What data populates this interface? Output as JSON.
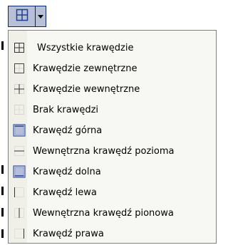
{
  "toolbar": {
    "button_icon": "all-borders-icon",
    "dropdown_icon": "dropdown-arrow-icon"
  },
  "menu": {
    "items": [
      {
        "label": "Wszystkie krawędzie",
        "icon": "all-borders-icon"
      },
      {
        "label": "Krawędzie zewnętrzne",
        "icon": "outside-borders-icon"
      },
      {
        "label": "Krawędzie wewnętrzne",
        "icon": "inside-borders-icon"
      },
      {
        "label": "Brak krawędzi",
        "icon": "no-border-icon"
      },
      {
        "label": "Krawędź górna",
        "icon": "top-border-icon"
      },
      {
        "label": "Wewnętrzna krawędź pozioma",
        "icon": "inside-horizontal-border-icon"
      },
      {
        "label": "Krawędź dolna",
        "icon": "bottom-border-icon"
      },
      {
        "label": "Krawędź lewa",
        "icon": "left-border-icon"
      },
      {
        "label": "Wewnętrzna krawędź pionowa",
        "icon": "inside-vertical-border-icon"
      },
      {
        "label": "Krawędź prawa",
        "icon": "right-border-icon"
      }
    ]
  },
  "colors": {
    "toolbar_selected": "#b7c0d6",
    "toolbar_border": "#0a246a",
    "menu_background": "#f7f7f3",
    "icon_blue": "#1f3f8f",
    "highlight_fill": "#b5bfdc"
  }
}
